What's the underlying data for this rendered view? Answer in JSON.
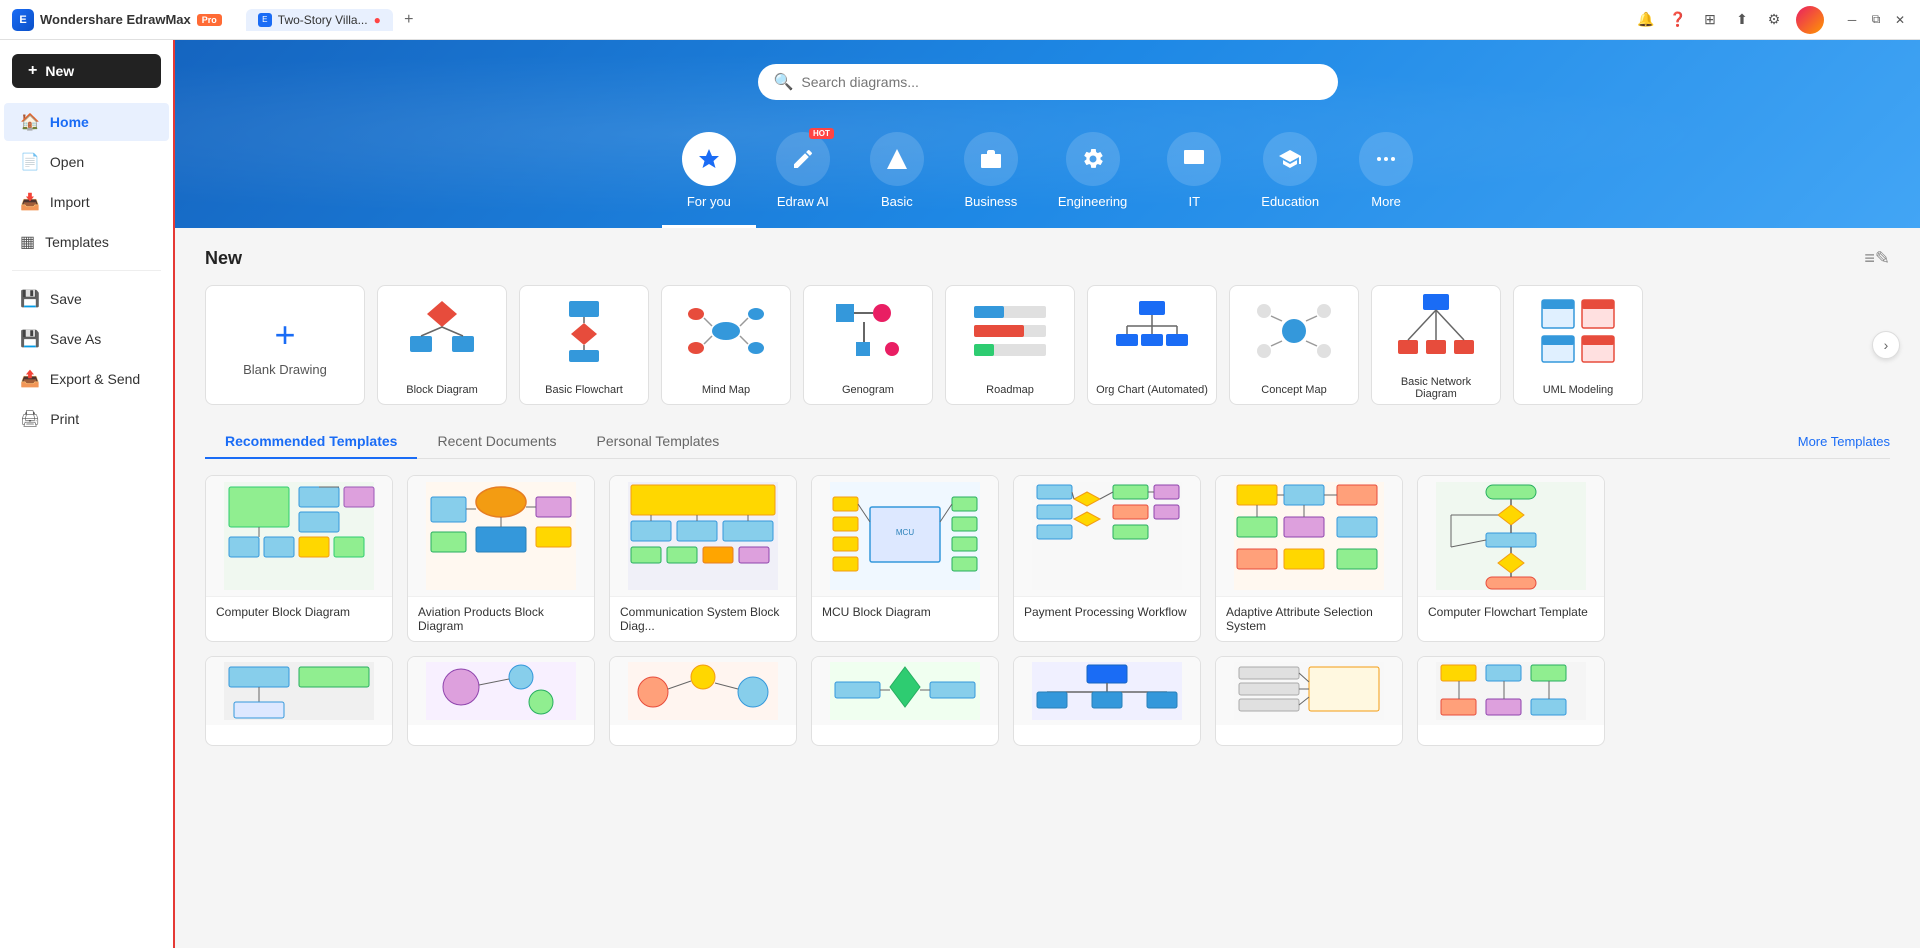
{
  "app": {
    "name": "Wondershare EdrawMax",
    "badge": "Pro",
    "tab1_label": "Two-Story Villa...",
    "tab1_modified": true
  },
  "new_button": "+ New",
  "sidebar": {
    "items": [
      {
        "id": "home",
        "label": "Home",
        "icon": "🏠",
        "active": true
      },
      {
        "id": "open",
        "label": "Open",
        "icon": "📂",
        "active": false
      },
      {
        "id": "import",
        "label": "Import",
        "icon": "📥",
        "active": false
      },
      {
        "id": "templates",
        "label": "Templates",
        "icon": "⊞",
        "active": false
      },
      {
        "id": "save",
        "label": "Save",
        "icon": "💾",
        "active": false
      },
      {
        "id": "save-as",
        "label": "Save As",
        "icon": "💾",
        "active": false
      },
      {
        "id": "export",
        "label": "Export & Send",
        "icon": "📤",
        "active": false
      },
      {
        "id": "print",
        "label": "Print",
        "icon": "🖨",
        "active": false
      }
    ]
  },
  "hero": {
    "search_placeholder": "Search diagrams...",
    "categories": [
      {
        "id": "for-you",
        "label": "For you",
        "icon": "✦",
        "active": true
      },
      {
        "id": "edraw-ai",
        "label": "Edraw AI",
        "icon": "✏",
        "active": false,
        "hot": true
      },
      {
        "id": "basic",
        "label": "Basic",
        "icon": "◆",
        "active": false
      },
      {
        "id": "business",
        "label": "Business",
        "icon": "🏢",
        "active": false
      },
      {
        "id": "engineering",
        "label": "Engineering",
        "icon": "⚙",
        "active": false
      },
      {
        "id": "it",
        "label": "IT",
        "icon": "🖥",
        "active": false
      },
      {
        "id": "education",
        "label": "Education",
        "icon": "🎓",
        "active": false
      },
      {
        "id": "more",
        "label": "More",
        "icon": "⋯",
        "active": false
      }
    ]
  },
  "new_section": {
    "title": "New",
    "blank_label": "Blank Drawing",
    "diagrams": [
      {
        "id": "block",
        "label": "Block Diagram"
      },
      {
        "id": "flowchart",
        "label": "Basic Flowchart"
      },
      {
        "id": "mindmap",
        "label": "Mind Map"
      },
      {
        "id": "genogram",
        "label": "Genogram"
      },
      {
        "id": "roadmap",
        "label": "Roadmap"
      },
      {
        "id": "orgchart",
        "label": "Org Chart (Automated)"
      },
      {
        "id": "concept",
        "label": "Concept Map"
      },
      {
        "id": "network",
        "label": "Basic Network Diagram"
      },
      {
        "id": "uml",
        "label": "UML Modeling"
      }
    ]
  },
  "templates_section": {
    "tabs": [
      {
        "id": "recommended",
        "label": "Recommended Templates",
        "active": true
      },
      {
        "id": "recent",
        "label": "Recent Documents",
        "active": false
      },
      {
        "id": "personal",
        "label": "Personal Templates",
        "active": false
      }
    ],
    "more_label": "More Templates",
    "templates": [
      {
        "id": "computer-block",
        "label": "Computer Block Diagram"
      },
      {
        "id": "aviation-block",
        "label": "Aviation Products Block Diagram"
      },
      {
        "id": "comm-block",
        "label": "Communication System Block Diag..."
      },
      {
        "id": "mcu-block",
        "label": "MCU Block Diagram"
      },
      {
        "id": "payment-workflow",
        "label": "Payment Processing Workflow"
      },
      {
        "id": "adaptive-attr",
        "label": "Adaptive Attribute Selection System"
      },
      {
        "id": "computer-flowchart",
        "label": "Computer Flowchart Template"
      }
    ]
  }
}
